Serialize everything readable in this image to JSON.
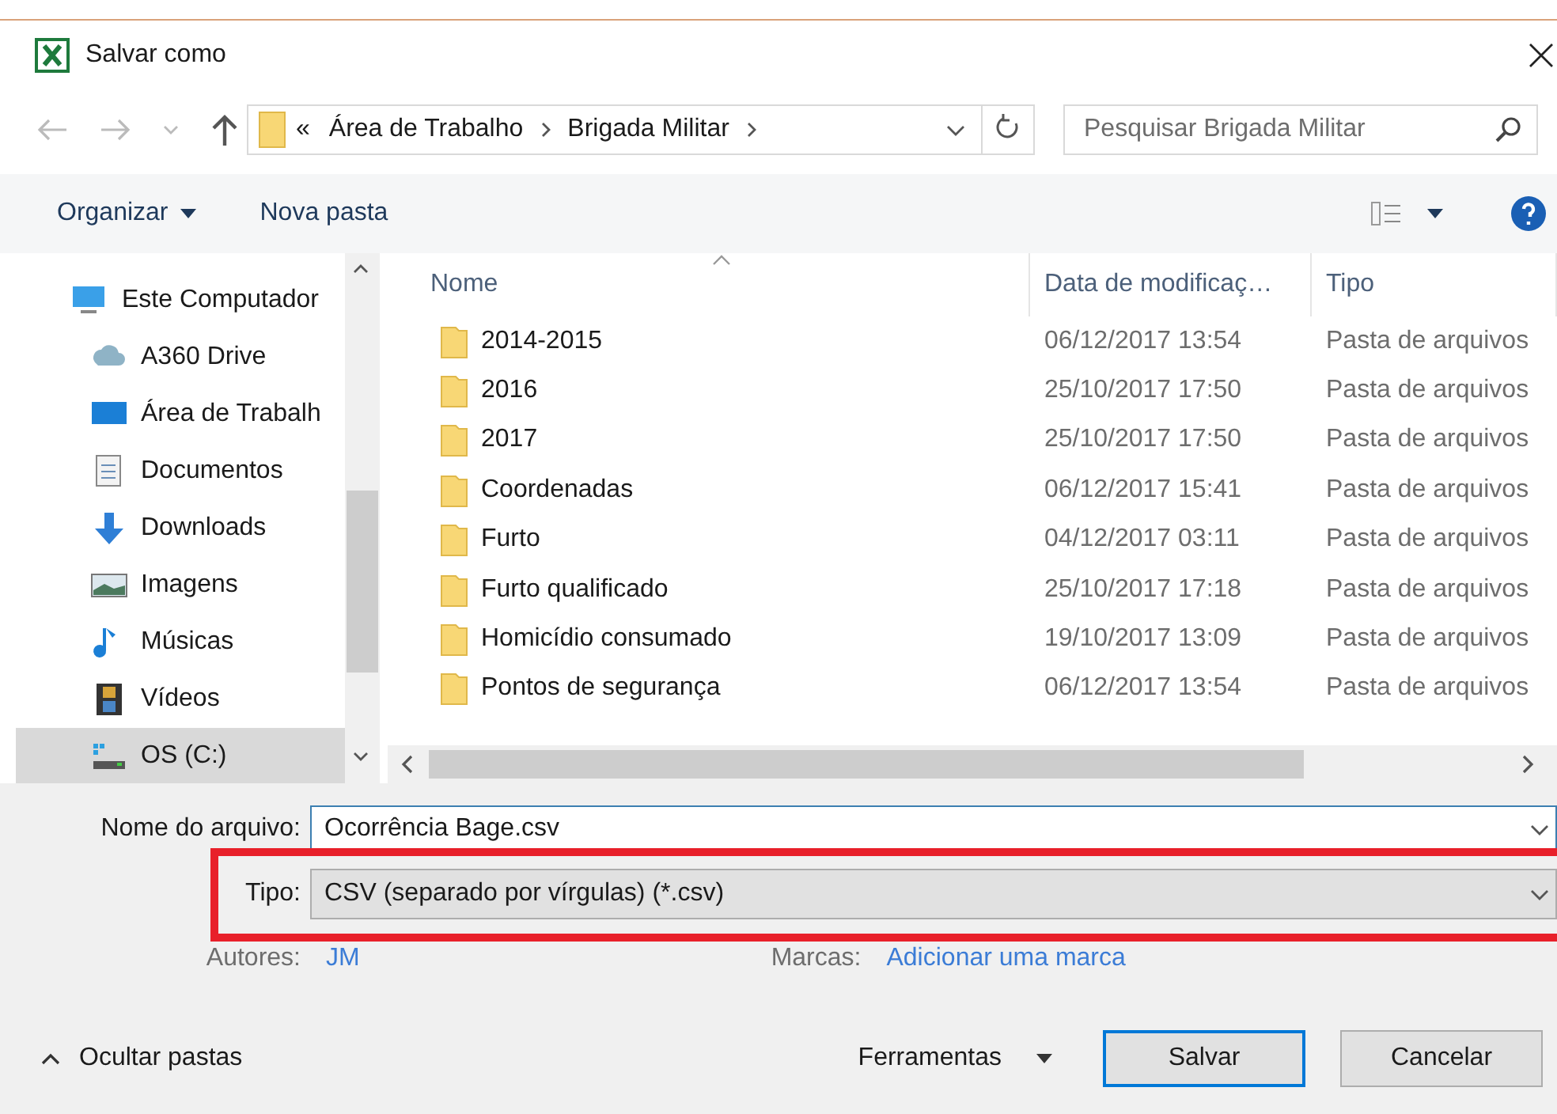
{
  "window": {
    "title": "Salvar como"
  },
  "address": {
    "overflow": "«",
    "crumbs": [
      "Área de Trabalho",
      "Brigada Militar"
    ]
  },
  "search": {
    "placeholder": "Pesquisar Brigada Militar"
  },
  "toolbar": {
    "organize": "Organizar",
    "new_folder": "Nova pasta"
  },
  "sidebar": {
    "items": [
      {
        "label": "Este Computador",
        "kind": "computer",
        "selected": false,
        "children": [
          {
            "label": "A360 Drive",
            "kind": "cloud",
            "selected": false
          },
          {
            "label": "Área de Trabalh",
            "kind": "desktop",
            "selected": false
          },
          {
            "label": "Documentos",
            "kind": "document",
            "selected": false
          },
          {
            "label": "Downloads",
            "kind": "download",
            "selected": false
          },
          {
            "label": "Imagens",
            "kind": "image",
            "selected": false
          },
          {
            "label": "Músicas",
            "kind": "music",
            "selected": false
          },
          {
            "label": "Vídeos",
            "kind": "video",
            "selected": false
          },
          {
            "label": "OS (C:)",
            "kind": "drive",
            "selected": true
          }
        ]
      }
    ]
  },
  "table": {
    "columns": [
      "Nome",
      "Data de modificaç…",
      "Tipo"
    ],
    "rows": [
      {
        "name": "2014-2015",
        "date": "06/12/2017 13:54",
        "type": "Pasta de arquivos"
      },
      {
        "name": "2016",
        "date": "25/10/2017 17:50",
        "type": "Pasta de arquivos"
      },
      {
        "name": "2017",
        "date": "25/10/2017 17:50",
        "type": "Pasta de arquivos"
      },
      {
        "name": "Coordenadas",
        "date": "06/12/2017 15:41",
        "type": "Pasta de arquivos"
      },
      {
        "name": "Furto",
        "date": "04/12/2017 03:11",
        "type": "Pasta de arquivos"
      },
      {
        "name": "Furto qualificado",
        "date": "25/10/2017 17:18",
        "type": "Pasta de arquivos"
      },
      {
        "name": "Homicídio consumado",
        "date": "19/10/2017 13:09",
        "type": "Pasta de arquivos"
      },
      {
        "name": "Pontos de segurança",
        "date": "06/12/2017 13:54",
        "type": "Pasta de arquivos"
      }
    ]
  },
  "form": {
    "filename_label": "Nome do arquivo:",
    "filename": "Ocorrência Bage.csv",
    "type_label": "Tipo:",
    "type": "CSV (separado por vírgulas) (*.csv)",
    "authors_label": "Autores:",
    "authors": "JM",
    "tags_label": "Marcas:",
    "tags": "Adicionar uma marca"
  },
  "footer": {
    "toggle": "Ocultar pastas",
    "tools": "Ferramentas",
    "save": "Salvar",
    "cancel": "Cancelar"
  }
}
